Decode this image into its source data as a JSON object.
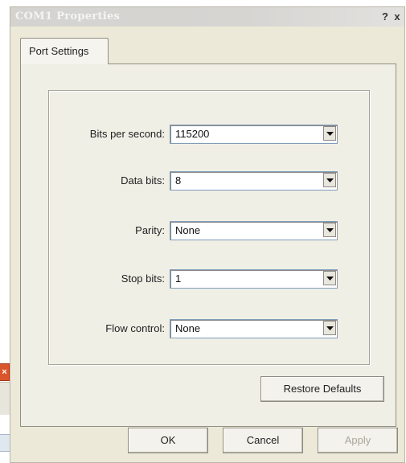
{
  "window": {
    "title": "COM1 Properties",
    "help_label": "?",
    "close_label": "x"
  },
  "tabs": [
    {
      "label": "Port Settings",
      "selected": true
    }
  ],
  "port_settings": {
    "bits_per_second": {
      "label": "Bits per second:",
      "value": "115200"
    },
    "data_bits": {
      "label": "Data bits:",
      "value": "8"
    },
    "parity": {
      "label": "Parity:",
      "value": "None"
    },
    "stop_bits": {
      "label": "Stop bits:",
      "value": "1"
    },
    "flow_control": {
      "label": "Flow control:",
      "value": "None"
    }
  },
  "buttons": {
    "restore_defaults": "Restore Defaults",
    "ok": "OK",
    "cancel": "Cancel",
    "apply": "Apply"
  },
  "icons": {
    "combo_arrow": "chevron-down-icon",
    "background_close": "close-icon"
  },
  "colors": {
    "dialog_face": "#ece9d8",
    "panel": "#f0efe6",
    "combo_border": "#7f9db9",
    "disabled_text": "#a9a79c",
    "background_close": "#d9552c"
  }
}
